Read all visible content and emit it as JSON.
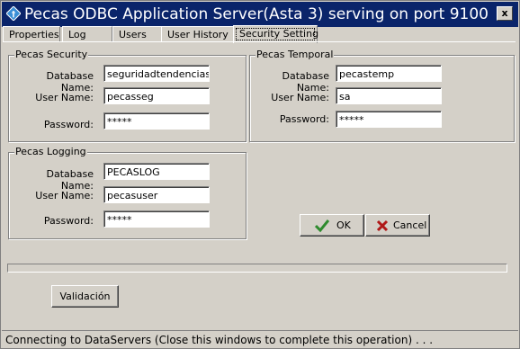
{
  "window": {
    "title": "Pecas ODBC Application Server(Asta 3) serving on  port 9100",
    "close_glyph": "x",
    "app_icon": "diamond-app-icon"
  },
  "tabs": [
    {
      "label": "Properties",
      "active": false
    },
    {
      "label": "Log",
      "active": false
    },
    {
      "label": "Users",
      "active": false
    },
    {
      "label": "User History",
      "active": false
    },
    {
      "label": "Security Setting",
      "active": true
    }
  ],
  "security": {
    "title": "Pecas Security",
    "database_label": "Database Name:",
    "database_value": "seguridadtendencias",
    "user_label": "User Name:",
    "user_value": "pecasseg",
    "password_label": "Password:",
    "password_value": "*****"
  },
  "temporal": {
    "title": "Pecas Temporal",
    "database_label": "Database Name:",
    "database_value": "pecastemp",
    "user_label": "User Name:",
    "user_value": "sa",
    "password_label": "Password:",
    "password_value": "*****"
  },
  "logging": {
    "title": "Pecas Logging",
    "database_label": "Database Name:",
    "database_value": "PECASLOG",
    "user_label": "User Name:",
    "user_value": "pecasuser",
    "password_label": "Password:",
    "password_value": "*****"
  },
  "buttons": {
    "ok_label": "OK",
    "cancel_label": "Cancel",
    "validacion_label": "Validación"
  },
  "progress": {
    "value": 0
  },
  "status": {
    "text": "Connecting to DataServers (Close this windows to complete this operation) . . ."
  },
  "colors": {
    "title_bar": "#0a246a",
    "ok_check": "#2e8b2e",
    "cancel_x": "#b01818"
  }
}
